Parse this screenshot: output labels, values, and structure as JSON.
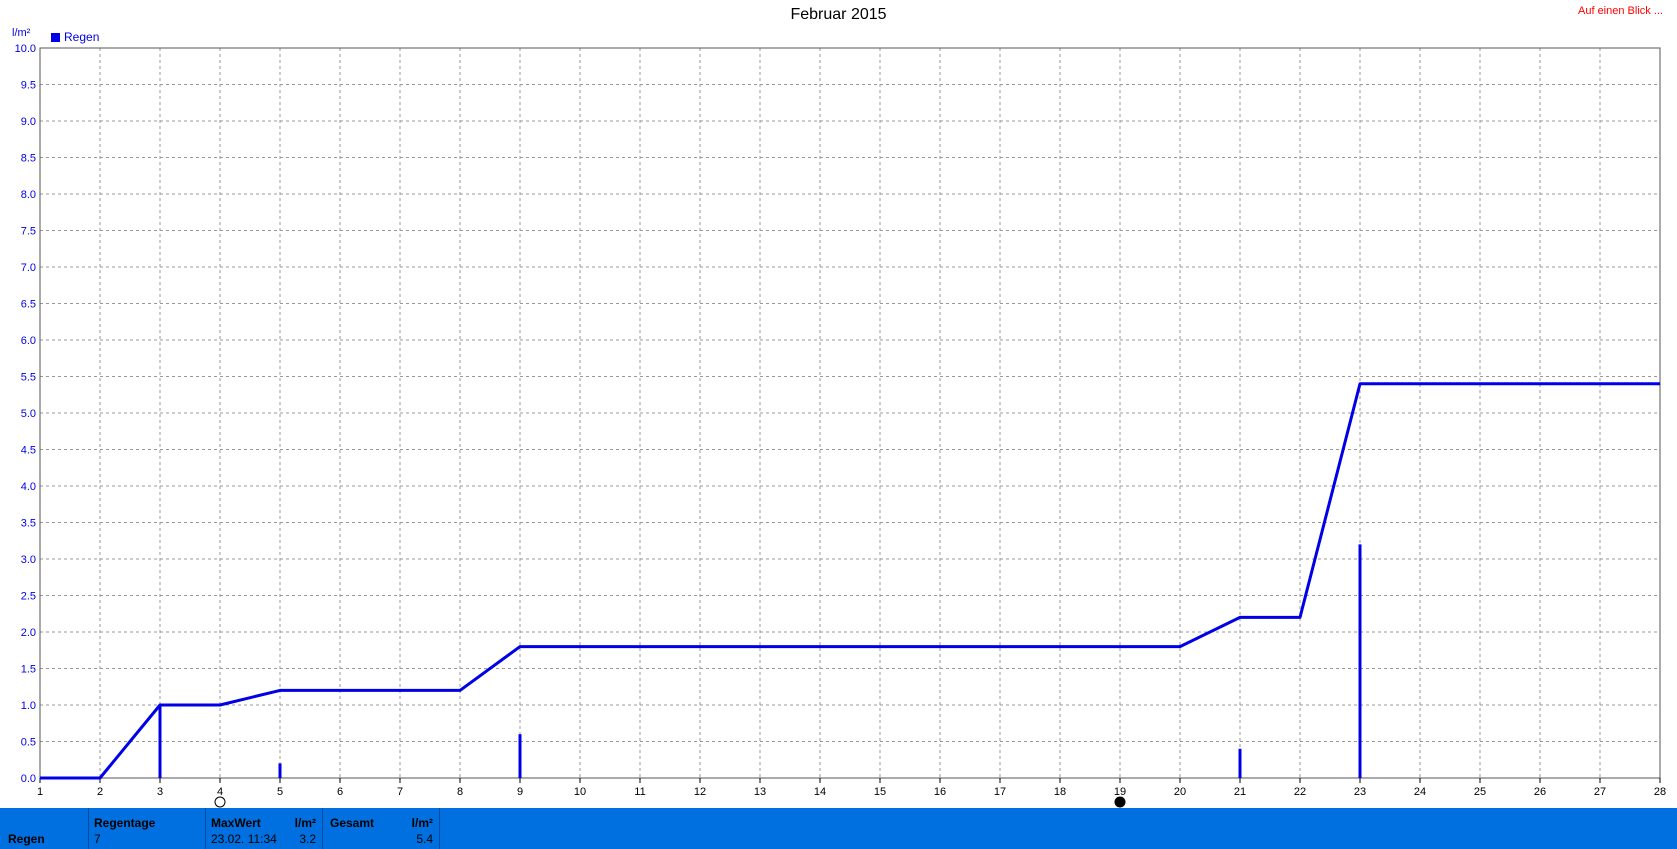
{
  "page": {
    "title": "Februar 2015",
    "link": "Auf einen Blick ..."
  },
  "colors": {
    "series": "#0000e6",
    "grid": "#999999",
    "footer_bg": "#0070e0",
    "link": "#ff0000"
  },
  "chart_data": {
    "type": "line",
    "ylabel": "l/m²",
    "xlim": [
      1,
      28
    ],
    "ylim": [
      0,
      10
    ],
    "x_ticks": [
      1,
      2,
      3,
      4,
      5,
      6,
      7,
      8,
      9,
      10,
      11,
      12,
      13,
      14,
      15,
      16,
      17,
      18,
      19,
      20,
      21,
      22,
      23,
      24,
      25,
      26,
      27,
      28
    ],
    "y_ticks": [
      "0.0",
      "0.5",
      "1.0",
      "1.5",
      "2.0",
      "2.5",
      "3.0",
      "3.5",
      "4.0",
      "4.5",
      "5.0",
      "5.5",
      "6.0",
      "6.5",
      "7.0",
      "7.5",
      "8.0",
      "8.5",
      "9.0",
      "9.5",
      "10.0"
    ],
    "legend": [
      {
        "name": "Regen",
        "color": "#0000e6"
      }
    ],
    "series": [
      {
        "name": "Regen",
        "kind": "cumulative-line",
        "x": [
          1,
          2,
          3,
          4,
          5,
          8,
          9,
          20,
          21,
          22,
          23,
          28
        ],
        "y": [
          0,
          0,
          1.0,
          1.0,
          1.2,
          1.2,
          1.8,
          1.8,
          2.2,
          2.2,
          5.4,
          5.4
        ]
      },
      {
        "name": "Regen",
        "kind": "daily-bars",
        "x": [
          3,
          5,
          9,
          21,
          23
        ],
        "y": [
          1.0,
          0.2,
          0.6,
          0.4,
          3.2
        ]
      }
    ],
    "moon_markers": [
      {
        "x": 4,
        "phase": "full-moon"
      },
      {
        "x": 19,
        "phase": "new-moon"
      }
    ]
  },
  "footer": {
    "row_label": "Regen",
    "rain_days_header": "Regentage",
    "rain_days_value": "7",
    "max_header": "MaxWert",
    "max_unit": "l/m²",
    "max_date": "23.02.  11:34",
    "max_value": "3.2",
    "total_header": "Gesamt",
    "total_unit": "l/m²",
    "total_value": "5.4"
  }
}
